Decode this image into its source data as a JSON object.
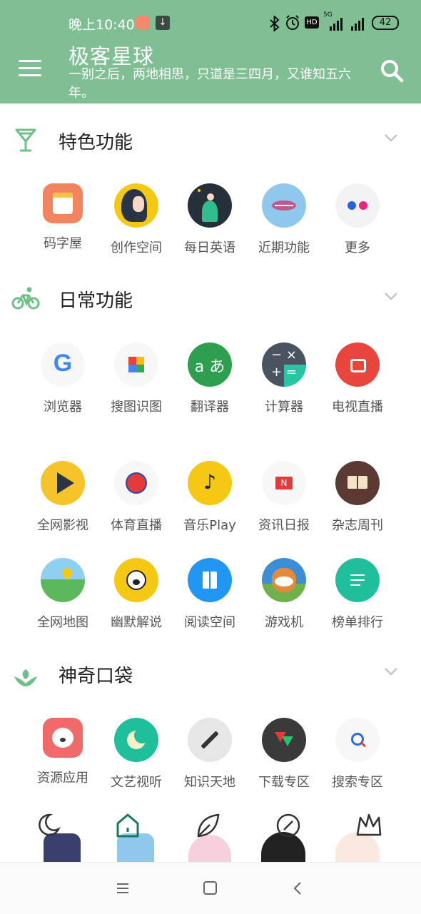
{
  "status_bar": {
    "time": "晚上10:40",
    "network": "5G",
    "battery": "42"
  },
  "header": {
    "title": "极客星球",
    "subtitle": "一别之后，两地相思，只道是三四月，又谁知五六年。"
  },
  "sections": [
    {
      "title": "特色功能",
      "icon": "cocktail-glass-icon",
      "items": [
        {
          "label": "码字屋",
          "icon": "notepad-icon"
        },
        {
          "label": "创作空间",
          "icon": "girl-illustration-icon"
        },
        {
          "label": "每日英语",
          "icon": "fairy-illustration-icon"
        },
        {
          "label": "近期功能",
          "icon": "fish-illustration-icon"
        },
        {
          "label": "更多",
          "icon": "two-dots-icon"
        }
      ]
    },
    {
      "title": "日常功能",
      "icon": "bicycle-icon",
      "items": [
        {
          "label": "浏览器",
          "icon": "google-g-icon"
        },
        {
          "label": "搜图识图",
          "icon": "pinwheel-icon"
        },
        {
          "label": "翻译器",
          "icon": "translate-icon"
        },
        {
          "label": "计算器",
          "icon": "calculator-icon"
        },
        {
          "label": "电视直播",
          "icon": "tv-icon"
        },
        {
          "label": "全网影视",
          "icon": "play-icon"
        },
        {
          "label": "体育直播",
          "icon": "basketball-icon"
        },
        {
          "label": "音乐Play",
          "icon": "music-note-icon"
        },
        {
          "label": "资讯日报",
          "icon": "news-icon"
        },
        {
          "label": "杂志周刊",
          "icon": "book-icon"
        },
        {
          "label": "全网地图",
          "icon": "map-icon"
        },
        {
          "label": "幽默解说",
          "icon": "emoji-face-icon"
        },
        {
          "label": "阅读空间",
          "icon": "open-book-icon"
        },
        {
          "label": "游戏机",
          "icon": "cow-game-icon"
        },
        {
          "label": "榜单排行",
          "icon": "list-icon"
        }
      ]
    },
    {
      "title": "神奇口袋",
      "icon": "sprout-icon",
      "items": [
        {
          "label": "资源应用",
          "icon": "dog-icon"
        },
        {
          "label": "文艺视听",
          "icon": "moon-icon"
        },
        {
          "label": "知识天地",
          "icon": "pen-icon"
        },
        {
          "label": "下载专区",
          "icon": "download-arrows-icon"
        },
        {
          "label": "搜索专区",
          "icon": "magnifier-icon"
        }
      ]
    }
  ],
  "dock_icons": [
    "crescent-moon-icon",
    "home-icon",
    "leaf-icon",
    "compass-icon",
    "crown-icon"
  ],
  "nav_bar": [
    "menu-nav-icon",
    "home-nav-icon",
    "back-nav-icon"
  ]
}
